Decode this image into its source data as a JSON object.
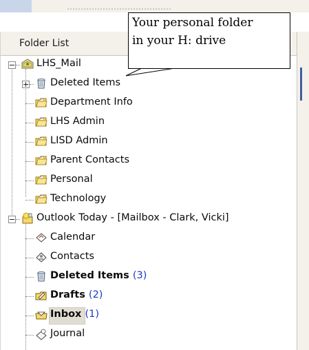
{
  "pane": {
    "header_label": "Folder List"
  },
  "callout": {
    "text": "Your personal folder\nin your H: drive"
  },
  "tree": {
    "lhs_mail": {
      "label": "LHS_Mail",
      "children": [
        {
          "label": "Deleted Items",
          "icon": "deleted-items-icon"
        },
        {
          "label": "Department Info",
          "icon": "folder-icon"
        },
        {
          "label": "LHS Admin",
          "icon": "folder-icon"
        },
        {
          "label": "LISD Admin",
          "icon": "folder-icon"
        },
        {
          "label": "Parent Contacts",
          "icon": "folder-icon"
        },
        {
          "label": "Personal",
          "icon": "folder-icon"
        },
        {
          "label": "Technology",
          "icon": "folder-icon"
        }
      ]
    },
    "outlook_today": {
      "label": "Outlook Today - [Mailbox - Clark, Vicki]",
      "children": [
        {
          "label": "Calendar",
          "icon": "calendar-icon"
        },
        {
          "label": "Contacts",
          "icon": "contacts-icon"
        },
        {
          "label": "Deleted Items",
          "count": "(3)",
          "icon": "deleted-items-icon",
          "bold": true
        },
        {
          "label": "Drafts",
          "count": "(2)",
          "icon": "drafts-icon",
          "bold": true
        },
        {
          "label": "Inbox",
          "count": "(1)",
          "icon": "inbox-icon",
          "bold": true,
          "selected": true
        },
        {
          "label": "Journal",
          "icon": "journal-icon"
        }
      ]
    }
  }
}
